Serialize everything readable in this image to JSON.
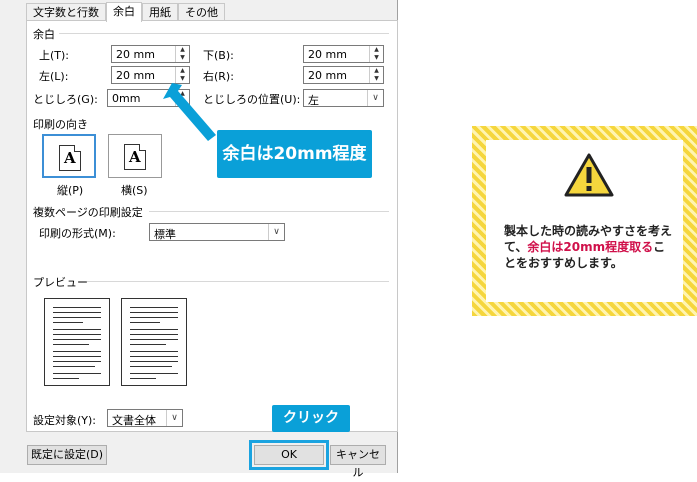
{
  "tabs": [
    "文字数と行数",
    "余白",
    "用紙",
    "その他"
  ],
  "margins": {
    "title": "余白",
    "top_label": "上(T):",
    "top_value": "20 mm",
    "bottom_label": "下(B):",
    "bottom_value": "20 mm",
    "left_label": "左(L):",
    "left_value": "20 mm",
    "right_label": "右(R):",
    "right_value": "20 mm",
    "gutter_label": "とじしろ(G):",
    "gutter_value": "0mm",
    "gutter_pos_label": "とじしろの位置(U):",
    "gutter_pos_value": "左"
  },
  "orientation": {
    "title": "印刷の向き",
    "portrait_label": "縦(P)",
    "landscape_label": "横(S)",
    "glyph": "A"
  },
  "multi_page": {
    "title": "複数ページの印刷設定",
    "format_label": "印刷の形式(M):",
    "format_value": "標準"
  },
  "preview": {
    "title": "プレビュー"
  },
  "apply_to": {
    "label": "設定対象(Y):",
    "value": "文書全体"
  },
  "buttons": {
    "default": "既定に設定(D)",
    "ok": "OK",
    "cancel": "キャンセル"
  },
  "callouts": {
    "margin": "余白は20mm程度",
    "click": "クリック"
  },
  "note": {
    "icon": "warning-icon",
    "text_1": "製本した時の読みやすさを考えて、",
    "text_red": "余白は20mm程度取る",
    "text_2": "ことをおすすめします。"
  },
  "colors": {
    "accent": "#0aa0d8",
    "warning": "#d0104a",
    "stripe": "#f5d63d"
  }
}
